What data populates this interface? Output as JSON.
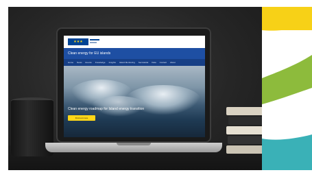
{
  "screen": {
    "site_title": "Clean energy for EU islands",
    "nav_items": [
      "Home",
      "News",
      "Events",
      "Knowledge",
      "Insights",
      "Island Monitoring",
      "Secretariat",
      "Data",
      "Contact",
      "About"
    ],
    "hero_title": "Clean energy roadmap for Island energy transition",
    "hero_button": "Find out more"
  },
  "colors": {
    "stripe_yellow": "#f7d117",
    "stripe_green": "#8dbb3c",
    "stripe_teal": "#3ab1b7",
    "ec_blue": "#004494",
    "site_blue": "#1e4fa3"
  }
}
